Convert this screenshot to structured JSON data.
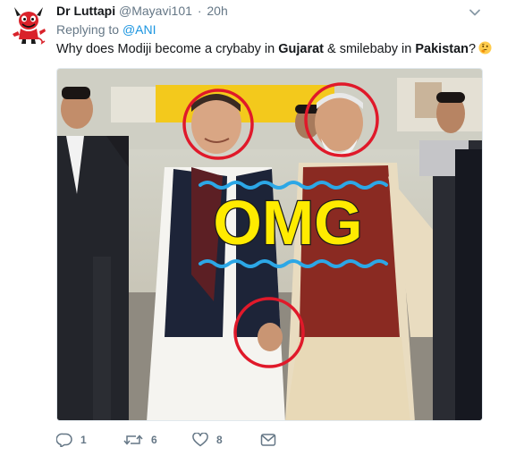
{
  "tweet": {
    "display_name": "Dr Luttapi",
    "handle": "@Mayavi101",
    "separator": "·",
    "time": "20h",
    "replying_prefix": "Replying to",
    "replying_to": "@ANI",
    "text": {
      "part1": "Why does Modiji become a crybaby in ",
      "bold1": "Gujarat",
      "part2": " & smilebaby in ",
      "bold2": "Pakistan",
      "part3": "?"
    },
    "image_overlay_text": "OMG",
    "actions": {
      "reply_count": "1",
      "retweet_count": "6",
      "like_count": "8"
    },
    "icons": [
      "avatar-devil-icon",
      "chevron-down-icon",
      "thinking-face-emoji",
      "reply-icon",
      "retweet-icon",
      "heart-icon",
      "message-icon"
    ],
    "colors": {
      "link": "#1b95e0",
      "secondary_text": "#657786",
      "overlay_text": "#ffeb00",
      "circle_marks": "#e0192a",
      "wave_lines": "#2ca7e6"
    }
  }
}
